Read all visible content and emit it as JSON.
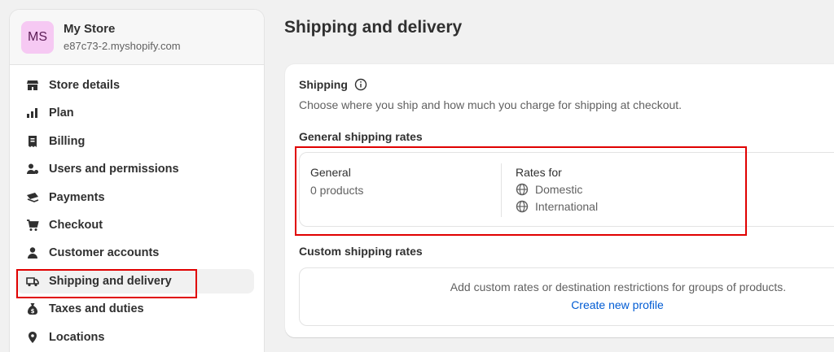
{
  "store": {
    "initials": "MS",
    "name": "My Store",
    "url": "e87c73-2.myshopify.com"
  },
  "sidebar": {
    "items": [
      {
        "label": "Store details",
        "icon": "store-icon"
      },
      {
        "label": "Plan",
        "icon": "plan-icon"
      },
      {
        "label": "Billing",
        "icon": "billing-icon"
      },
      {
        "label": "Users and permissions",
        "icon": "users-icon"
      },
      {
        "label": "Payments",
        "icon": "payments-icon"
      },
      {
        "label": "Checkout",
        "icon": "cart-icon"
      },
      {
        "label": "Customer accounts",
        "icon": "person-icon"
      },
      {
        "label": "Shipping and delivery",
        "icon": "truck-icon",
        "active": true
      },
      {
        "label": "Taxes and duties",
        "icon": "money-bag-icon"
      },
      {
        "label": "Locations",
        "icon": "location-pin-icon"
      }
    ]
  },
  "page": {
    "title": "Shipping and delivery"
  },
  "shipping_card": {
    "title": "Shipping",
    "description": "Choose where you ship and how much you charge for shipping at checkout.",
    "general_rates_label": "General shipping rates",
    "general": {
      "name": "General",
      "products": "0 products",
      "rates_for_label": "Rates for",
      "zones": [
        "Domestic",
        "International"
      ]
    },
    "custom_rates_label": "Custom shipping rates",
    "custom": {
      "text": "Add custom rates or destination restrictions for groups of products.",
      "link": "Create new profile"
    }
  },
  "colors": {
    "accent_link": "#005bd3",
    "highlight": "#e00000",
    "avatar_bg": "#f6c9f3"
  }
}
